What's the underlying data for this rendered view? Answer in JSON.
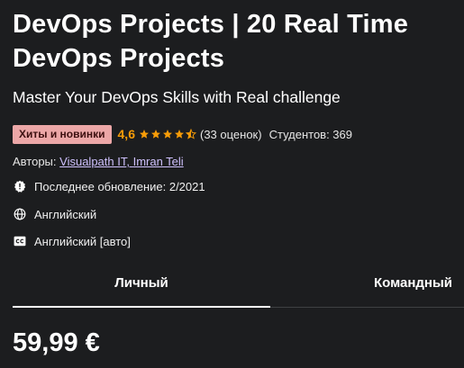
{
  "course": {
    "title": "DevOps Projects | 20 Real Time DevOps Projects",
    "subtitle": "Master Your DevOps Skills with Real challenge",
    "badge": "Хиты и новинки",
    "rating": "4,6",
    "stars_value": 4.5,
    "ratings_count": "(33 оценок)",
    "students": "Студентов: 369",
    "authors_label": "Авторы:",
    "authors": [
      "Visualpath IT",
      "Imran Teli"
    ],
    "author_separator": ", ",
    "last_updated": "Последнее обновление: 2/2021",
    "language": "Английский",
    "captions": "Английский [авто]"
  },
  "tabs": [
    {
      "label": "Личный",
      "active": true
    },
    {
      "label": "Командный",
      "active": false
    }
  ],
  "price": "59,99 €",
  "colors": {
    "background": "#1c1d1f",
    "badge_bg": "#eca7a7",
    "rating": "#f69c08",
    "link": "#cec0fc"
  },
  "icons": {
    "updated": "alert-badge-icon",
    "language": "globe-icon",
    "captions": "closed-captions-icon",
    "star": "star-icon"
  }
}
